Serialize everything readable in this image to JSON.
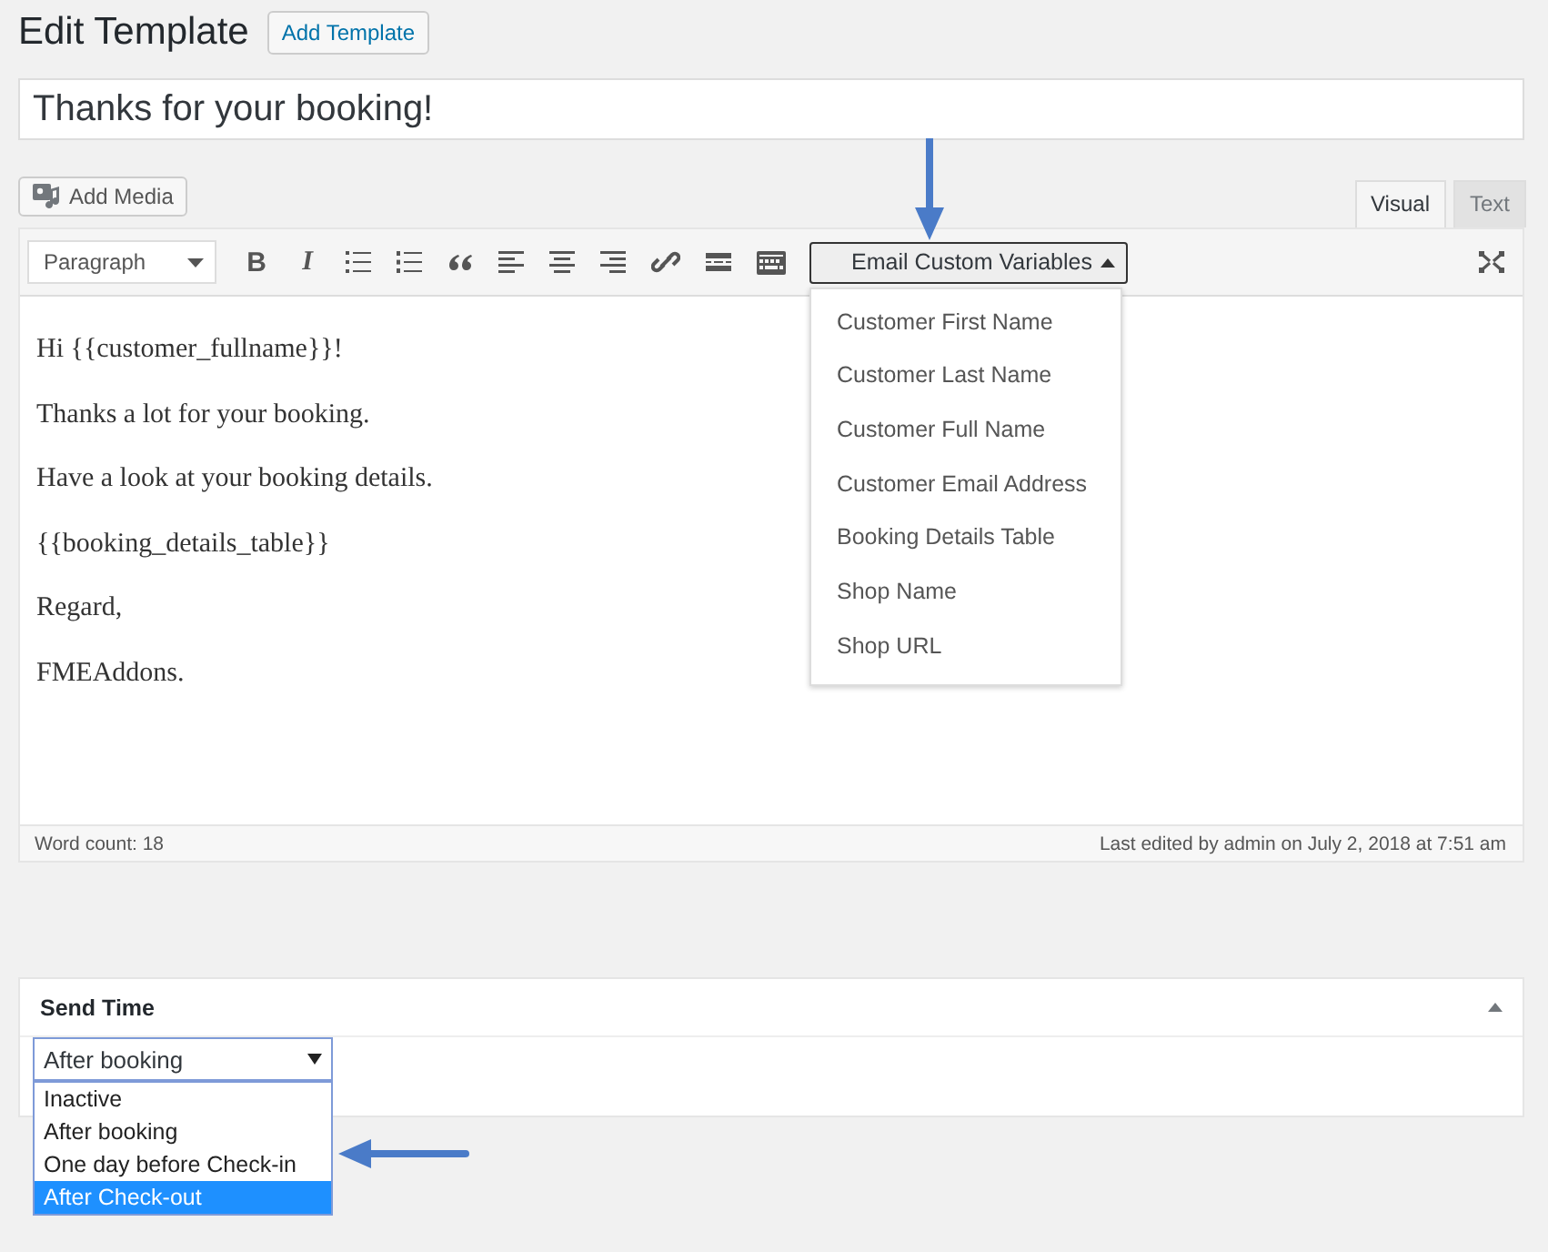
{
  "page": {
    "title": "Edit Template",
    "add_button": "Add Template"
  },
  "title_field": {
    "value": "Thanks for your booking!"
  },
  "add_media": "Add Media",
  "editor_tabs": [
    {
      "label": "Visual",
      "selected": true
    },
    {
      "label": "Text",
      "selected": false
    }
  ],
  "toolbar": {
    "format": "Paragraph",
    "bold": "B",
    "italic": "I",
    "variables_button": {
      "label": "Email Custom Variables",
      "expanded": true
    }
  },
  "variables_menu": [
    "Customer First Name",
    "Customer Last Name",
    "Customer Full Name",
    "Customer Email Address",
    "Booking Details Table",
    "Shop Name",
    "Shop URL"
  ],
  "content": [
    "Hi {{customer_fullname}}!",
    "Thanks a lot for your booking.",
    "Have a look at your booking details.",
    "{{booking_details_table}}",
    "Regard,",
    "FMEAddons."
  ],
  "status_bar": {
    "word_count": "Word count: 18",
    "last_edited": "Last edited by admin on July 2, 2018 at 7:51 am"
  },
  "send_time": {
    "title": "Send Time",
    "value": "After booking",
    "expanded": true,
    "options": [
      {
        "label": "Inactive",
        "highlighted": false
      },
      {
        "label": "After booking",
        "highlighted": false
      },
      {
        "label": "One day before Check-in",
        "highlighted": false
      },
      {
        "label": "After Check-out",
        "highlighted": true
      }
    ]
  }
}
